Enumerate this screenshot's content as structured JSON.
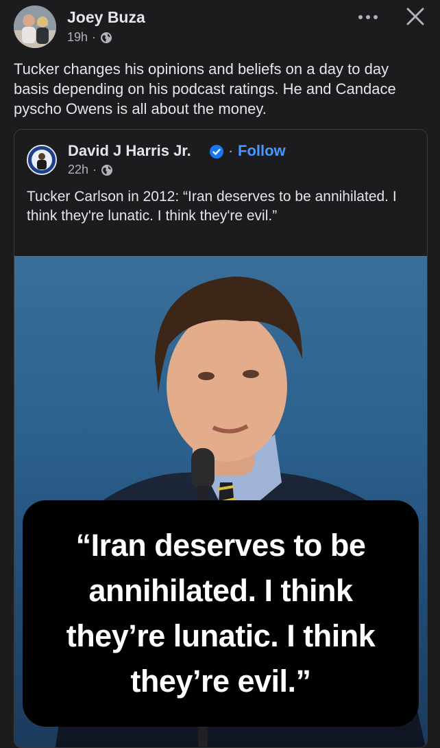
{
  "post": {
    "author": "Joey Buza",
    "time": "19h",
    "separator": "·",
    "audience_icon": "globe-icon",
    "text": "Tucker changes his opinions and beliefs on a day to day basis depending on his podcast ratings. He and Candace pyscho Owens is all about the money."
  },
  "shared": {
    "author": "David J Harris Jr.",
    "verified_icon": "verified-badge-icon",
    "follow_separator": "·",
    "follow_label": "Follow",
    "time": "22h",
    "separator": "·",
    "text": "Tucker Carlson in 2012: “Iran deserves to be annihilated. I think they're lunatic. I think they're evil.”",
    "image_quote": "“Iran deserves to be annihilated. I think they’re lunatic. I think they’re evil.”"
  },
  "colors": {
    "background": "#1c1c1e",
    "link": "#4599ff",
    "verified": "#1877f2",
    "secondary_text": "#b0b3b8"
  },
  "icons": [
    "more-options-icon",
    "close-icon",
    "globe-icon",
    "verified-badge-icon"
  ]
}
